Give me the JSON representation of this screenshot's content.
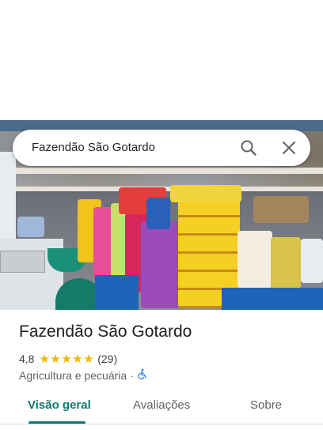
{
  "search": {
    "query": "Fazendão São Gotardo"
  },
  "place": {
    "name": "Fazendão São Gotardo",
    "rating": "4,8",
    "stars": "★★★★★",
    "review_count": "(29)",
    "category": "Agricultura e pecuária",
    "separator": "·"
  },
  "tabs": [
    {
      "label": "Visão geral",
      "active": true
    },
    {
      "label": "Avaliações",
      "active": false
    },
    {
      "label": "Sobre",
      "active": false
    }
  ],
  "colors": {
    "accent": "#0f7a6f",
    "star": "#f4b400",
    "link": "#1a73e8"
  }
}
